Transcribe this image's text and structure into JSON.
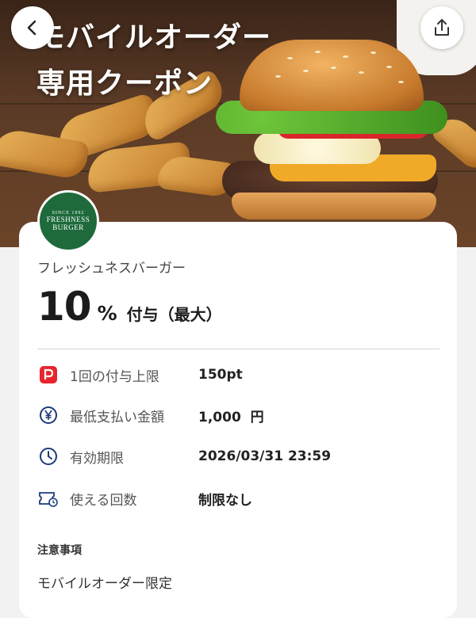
{
  "hero": {
    "title_line1": "モバイルオーダー",
    "title_line2": "専用クーポン"
  },
  "header": {
    "back_icon": "chevron-left-icon",
    "share_icon": "share-icon"
  },
  "coupon": {
    "logo_top": "SINCE 1992",
    "logo_name": "FRESHNESS BURGER",
    "store_name": "フレッシュネスバーガー",
    "discount_value": "10",
    "discount_unit": "%",
    "discount_suffix": "付与（最大）",
    "details": [
      {
        "icon": "paypay-icon",
        "label": "1回の付与上限",
        "value": "150pt"
      },
      {
        "icon": "yen-icon",
        "label": "最低支払い金額",
        "value": "1,000  円"
      },
      {
        "icon": "clock-icon",
        "label": "有効期限",
        "value": "2026/03/31 23:59"
      },
      {
        "icon": "ticket-icon",
        "label": "使える回数",
        "value": "制限なし"
      }
    ],
    "notes_title": "注意事項",
    "notes_body": "モバイルオーダー限定"
  },
  "colors": {
    "paypay_red": "#e8252c",
    "icon_blue": "#1a3b7a",
    "brand_green": "#1e6a3b"
  }
}
